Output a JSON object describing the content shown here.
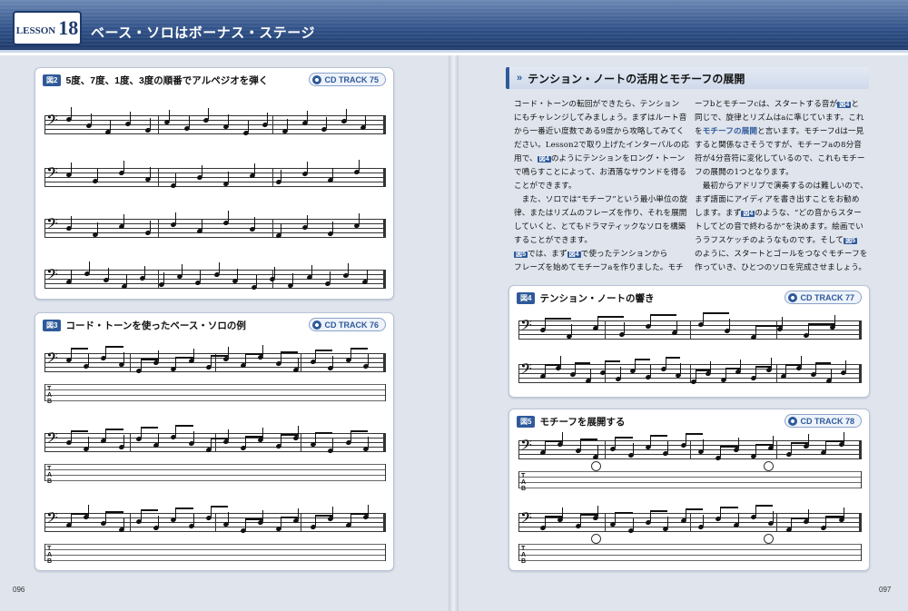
{
  "header": {
    "lesson_word": "LESSON",
    "lesson_num": "18",
    "title": "ベース・ソロはボーナス・ステージ"
  },
  "fig2": {
    "badge": "図2",
    "title": "5度、7度、1度、3度の順番でアルペジオを弾く",
    "cd": "CD TRACK 75",
    "rows": [
      {
        "chords": [
          {
            "t": "F△7"
          },
          {
            "t": "Em7(♭5)"
          },
          {
            "t": "A7"
          }
        ],
        "positions": [
          "3弦8F",
          "4弦8F"
        ],
        "labels": [
          "P5",
          "M7",
          "R",
          "M3",
          "P5",
          "M7",
          "R",
          "M3",
          "dim5",
          "♭7",
          "R",
          "♭3",
          "P5",
          "♭7",
          "R",
          "M3"
        ]
      },
      {
        "chords": [
          {
            "t": "Dm7"
          },
          {
            "t": "Cm7"
          },
          {
            "t": "F7"
          }
        ],
        "positions": [
          "3弦5F",
          "4弦3F",
          "3弦8F"
        ],
        "labels": [
          "P5",
          "♭7",
          "R",
          "♭3",
          "P5",
          "♭7",
          "R",
          "♭3",
          "P5",
          "♭7",
          "R",
          "M3"
        ]
      },
      {
        "chords": [
          {
            "t": "B♭△7"
          },
          {
            "t": "E♭7"
          }
        ],
        "positions": [
          "3弦5F",
          "4弦6F"
        ],
        "labels": [
          "P5",
          "M7",
          "R",
          "M3",
          "P5",
          "♭7",
          "R",
          "M3",
          "P5",
          "♭7",
          "R",
          "M3"
        ]
      },
      {
        "chords": [
          {
            "t": "Bm7(♭5)"
          },
          {
            "t": "E7(♭9)"
          },
          {
            "t": "Am7"
          },
          {
            "t": "A7"
          },
          {
            "t": "Gm7"
          },
          {
            "t": "C7"
          },
          {
            "t": "F"
          }
        ],
        "positions": [
          "3弦7F",
          "3弦7F"
        ],
        "labels": [
          "dim5",
          "♭7",
          "R",
          "♭3",
          "P5",
          "♭7",
          "R",
          "M3",
          "P5",
          "♭7",
          "R",
          "♭3",
          "P5",
          "♭7",
          "R",
          "♭3",
          "R"
        ]
      }
    ]
  },
  "fig3": {
    "badge": "図3",
    "title": "コード・トーンを使ったベース・ソロの例",
    "cd": "CD TRACK 76",
    "rows": [
      {
        "chords": [
          "F7",
          "B♭7",
          "F7"
        ],
        "labels": [
          "M3",
          "R",
          "♭7",
          "P5",
          "♭7",
          "R",
          "R",
          "♭7",
          "R",
          "♭7",
          "P5",
          "♭7"
        ],
        "tab": [
          "14",
          "14",
          "13",
          "15",
          "13",
          "15",
          "12",
          "13",
          "15",
          "12",
          "10",
          "6",
          "7",
          "8",
          "7",
          "8",
          "6",
          "8"
        ]
      },
      {
        "chords": [
          "B♭7",
          "Bdim7",
          "F7",
          "D7",
          "(Gm7)"
        ],
        "labels": [
          "M3",
          "R",
          "♭7",
          "P5",
          "P5",
          "♭7",
          "dim7",
          "R",
          "dim7",
          "dim5",
          "♭3",
          "R",
          "M3",
          "R",
          "P5",
          "R",
          "M3",
          "R",
          "♭7",
          "R",
          "R",
          "M3",
          "♭7"
        ],
        "tab": [
          "12",
          "15",
          "13",
          "15",
          "13",
          "15",
          "13",
          "16",
          "15",
          "13",
          "16",
          "10",
          "8",
          "10",
          "8",
          "10",
          "8",
          "11",
          "10",
          "11",
          "10"
        ]
      },
      {
        "chords": [
          "Gm7",
          "C7",
          "F7",
          "D7",
          "Gm7",
          "C7",
          "F7"
        ],
        "labels": [
          "R",
          "♭3",
          "R",
          "♭7",
          "P5",
          "R",
          "R",
          "♭7",
          "R",
          "ch",
          "P5",
          "M3",
          "R",
          "♭7",
          "R",
          "ch",
          "R",
          "♭3",
          "R",
          "♭7",
          "P5",
          "R",
          "ch"
        ],
        "tab": [
          "10",
          "8",
          "10",
          "8",
          "10",
          "8",
          "10",
          "8",
          "9",
          "10",
          "16",
          "17",
          "16",
          "17",
          "15",
          "17",
          "15",
          "18",
          "17",
          "18",
          "17",
          "15",
          "17",
          "16"
        ],
        "ottava": "8va"
      }
    ]
  },
  "section": {
    "title": "テンション・ノートの活用とモチーフの展開"
  },
  "body": {
    "col1": [
      "コード・トーンの転回ができたら、テンション",
      "にもチャレンジしてみましょう。まずはルート音",
      "から一番近い度数である9度から攻略してみてく",
      "ださい。Lesson2で取り上げたインターバルの応",
      "用で、",
      "のようにテンションをロング・トーン",
      "で鳴らすことによって、お洒落なサウンドを得る",
      "ことができます。",
      "　また、ソロでは“モチーフ”という最小単位の旋",
      "律、またはリズムのフレーズを作り、それを展開",
      "していくと、とてもドラマティックなソロを構築",
      "することができます。",
      "では、まず",
      "で使ったテンションから",
      "フレーズを始めてモチーフaを作りました。モチ"
    ],
    "col2": [
      "ーフbとモチーフcは、スタートする音が",
      "と",
      "同じで、旋律とリズムはaに準じています。これ",
      "を",
      "モチーフの展開",
      "と言います。モチーフdは一見",
      "すると関係なさそうですが、モチーフaの8分音",
      "符が4分音符に変化しているので、これもモチー",
      "フの展開の1つとなります。",
      "　最初からアドリブで演奏するのは難しいので、",
      "まず譜面にアイディアを書き出すことをお勧め",
      "します。まず",
      "のような、“どの音からスター",
      "トしてどの音で終わるか”を決めます。絵画でい",
      "うラフスケッチのようなものです。そして",
      "のように、スタートとゴールをつなぐモチーフを",
      "作っていき、ひとつのソロを完成させましょう。"
    ],
    "ref4": "図4",
    "ref5": "図5"
  },
  "fig4": {
    "badge": "図4",
    "title": "テンション・ノートの響き",
    "cd": "CD TRACK 77",
    "rows": [
      {
        "chords": [
          "Cm7",
          "F7",
          "B♭△7",
          "E♭△7"
        ],
        "labels": [
          "T9",
          "M3",
          "T9",
          "M7"
        ]
      },
      {
        "chords": [
          "Am7(♭5)",
          "D7",
          "Gm7"
        ],
        "labels": [
          "dim5",
          "M3",
          "R",
          "T11",
          "P5",
          "T11",
          "♭3"
        ]
      }
    ]
  },
  "fig5": {
    "badge": "図5",
    "title": "モチーフを展開する",
    "cd": "CD TRACK 78",
    "rows": [
      {
        "chords": [
          "Cm7",
          "F7",
          "B♭△7",
          "E♭7"
        ],
        "motifs": [
          "a",
          "b"
        ],
        "labels": [
          "T9",
          "M3",
          "♭3",
          "M3",
          "T9",
          "P5",
          "M3"
        ],
        "tab": [
          "7",
          "8",
          "7",
          "8",
          "7",
          "8",
          "7",
          "8",
          "9",
          "10",
          "8",
          "8",
          "10",
          "8",
          "10",
          "8",
          "10",
          "6"
        ]
      },
      {
        "chords": [
          "Am7(♭5)",
          "D7",
          "Gm7"
        ],
        "motifs": [
          "c",
          "d"
        ],
        "labels": [
          "dim5",
          "P4",
          "T♭13",
          "M3",
          "R",
          "P5",
          "T♭13",
          "R",
          "P5",
          "T11",
          "♭3"
        ],
        "tab": [
          "7",
          "8",
          "7",
          "8",
          "7",
          "8",
          "7",
          "8",
          "7",
          "10",
          "10",
          "10",
          "10",
          "10",
          "10",
          "8",
          "10",
          "8"
        ]
      }
    ]
  },
  "pages": {
    "left": "096",
    "right": "097"
  }
}
